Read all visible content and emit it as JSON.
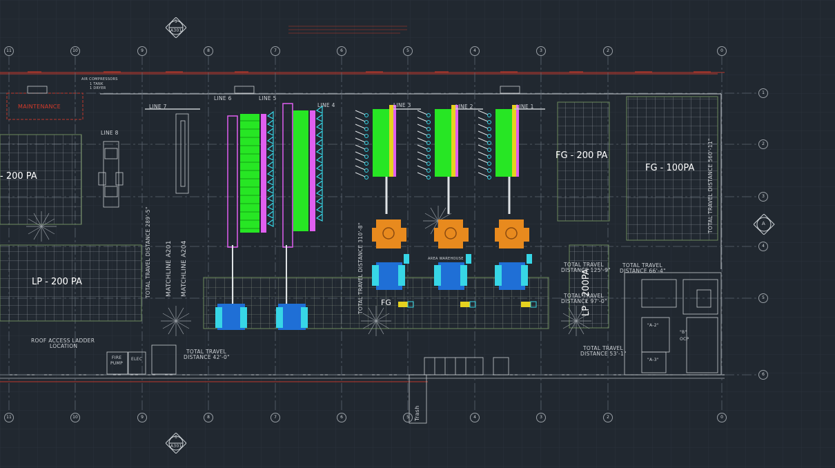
{
  "zones": {
    "fg_200": "FG - 200 PA",
    "fg_100": "FG - 100PA",
    "lp_200_left": "LP - 200 PA",
    "lp_200_mid": "LP - 200PA",
    "partial_200": "- 200 PA",
    "fg_small": "FG"
  },
  "lines": {
    "line1": "LINE 1",
    "line2": "LINE 2",
    "line3": "LINE 3",
    "line4": "LINE 4",
    "line5": "LINE 5",
    "line6": "LINE 6",
    "line7": "LINE 7",
    "line8": "LINE 8"
  },
  "labels": {
    "maintenance": "MAINTENANCE",
    "air_compressors": "AIR COMPRESSORS",
    "air_sub": "1 TANK",
    "air_sub2": "1 DRYER",
    "roof_access": "ROOF ACCESS LADDER",
    "roof_access2": "LOCATION",
    "fire_pump": "FIRE",
    "fire_pump2": "PUMP",
    "elec": "ELEC",
    "trash": "Trash",
    "area_warehouse": "AREA WAREHOUSE",
    "room_a2": "\"A-2\"",
    "room_a3": "\"A-3\"",
    "room_b": "\"B\"",
    "room_b2": "OCP",
    "matchline_a201": "MATCHLINE A201",
    "matchline_a204": "MATCHLINE A204"
  },
  "distances": {
    "td_42": "TOTAL TRAVEL",
    "td_42b": "DISTANCE 42'-0\"",
    "td_66": "TOTAL TRAVEL",
    "td_66b": "DISTANCE 66'-4\"",
    "td_125": "TOTAL TRAVEL",
    "td_125b": "DISTANCE 125'-9\"",
    "td_97": "TOTAL TRAVEL",
    "td_97b": "DISTANCE 97'-0\"",
    "td_53": "TOTAL TRAVEL",
    "td_53b": "DISTANCE 53'-1\"",
    "td_vert_mid": "TOTAL TRAVEL DISTANCE 310'-8\"",
    "td_vert_left": "TOTAL TRAVEL DISTANCE 289'-5\"",
    "td_vert_right": "TOTAL TRAVEL DISTANCE 560'-11\""
  },
  "section_markers": {
    "top_num": "5",
    "top_sheet": "A301",
    "bottom_num": "6",
    "bottom_sheet": "A301",
    "right_letter": "A"
  },
  "grid_columns": [
    "11",
    "10",
    "9",
    "8",
    "7",
    "6",
    "5",
    "4",
    "3",
    "2",
    "0"
  ],
  "grid_rows": [
    "1",
    "2",
    "3",
    "4",
    "5",
    "6"
  ],
  "colors": {
    "background": "#212830",
    "grid": "#2c343d",
    "green_machine": "#27e624",
    "magenta": "#e05ff0",
    "cyan": "#37d6e6",
    "orange": "#e88a1e",
    "blue": "#1f6fd6",
    "red_wall": "#c0392b",
    "yellow": "#e6d21f"
  }
}
